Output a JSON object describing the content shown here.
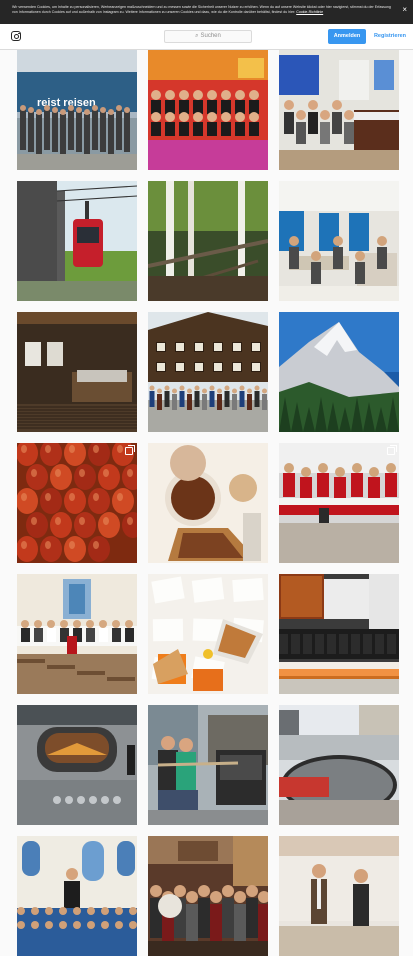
{
  "cookie_bar": {
    "text": "Wir verwenden Cookies, um Inhalte zu personalisieren, Werbeanzeigen maßzuschneidern und zu messen sowie die Sicherheit unserer Nutzer zu erhöhen. Wenn du auf unsere Website klickst oder hier navigierst, stimmst du der Erfassung von Informationen durch Cookies auf und außerhalb von Instagram zu. Weitere Informationen zu unseren Cookies und dazu, wie du die Kontrolle darüber behältst, findest du hier:",
    "link": "Cookie-Richtlinie",
    "close": "×"
  },
  "header": {
    "search_placeholder": "Suchen",
    "search_icon": "⌕",
    "login": "Anmelden",
    "register": "Registrieren"
  },
  "tiles": [
    {
      "name": "bus-group-photo",
      "scene": "bus",
      "multi": false
    },
    {
      "name": "red-room-group",
      "scene": "redroom",
      "multi": false
    },
    {
      "name": "piano-room",
      "scene": "piano",
      "multi": false
    },
    {
      "name": "cable-car",
      "scene": "cablecar",
      "multi": false
    },
    {
      "name": "forest-trees",
      "scene": "forest",
      "multi": false
    },
    {
      "name": "classroom-blue-curtains",
      "scene": "classroom",
      "multi": false
    },
    {
      "name": "wooden-bedroom",
      "scene": "bedroom",
      "multi": false
    },
    {
      "name": "wooden-chalet",
      "scene": "chalet",
      "multi": false
    },
    {
      "name": "mountain-peak",
      "scene": "mountain",
      "multi": false
    },
    {
      "name": "red-easter-eggs",
      "scene": "eggs",
      "multi": true
    },
    {
      "name": "chocolate-baking",
      "scene": "baking",
      "multi": false
    },
    {
      "name": "choir-red",
      "scene": "choir",
      "multi": true
    },
    {
      "name": "church-hall",
      "scene": "church",
      "multi": false
    },
    {
      "name": "pizza-table",
      "scene": "pizza",
      "multi": false
    },
    {
      "name": "dark-hall",
      "scene": "darkhall",
      "multi": false
    },
    {
      "name": "oven-bread",
      "scene": "oven",
      "multi": false
    },
    {
      "name": "bread-oven-two-women",
      "scene": "bakers",
      "multi": false
    },
    {
      "name": "street-basket",
      "scene": "street",
      "multi": false
    },
    {
      "name": "church-choir-conductor",
      "scene": "conductor",
      "multi": false
    },
    {
      "name": "crowd-interior",
      "scene": "crowd",
      "multi": false
    },
    {
      "name": "stage-couple",
      "scene": "stage",
      "multi": false
    }
  ],
  "colors": {
    "accent": "#3897f0",
    "cookie_bg": "#262626",
    "page_bg": "#fafafa"
  }
}
